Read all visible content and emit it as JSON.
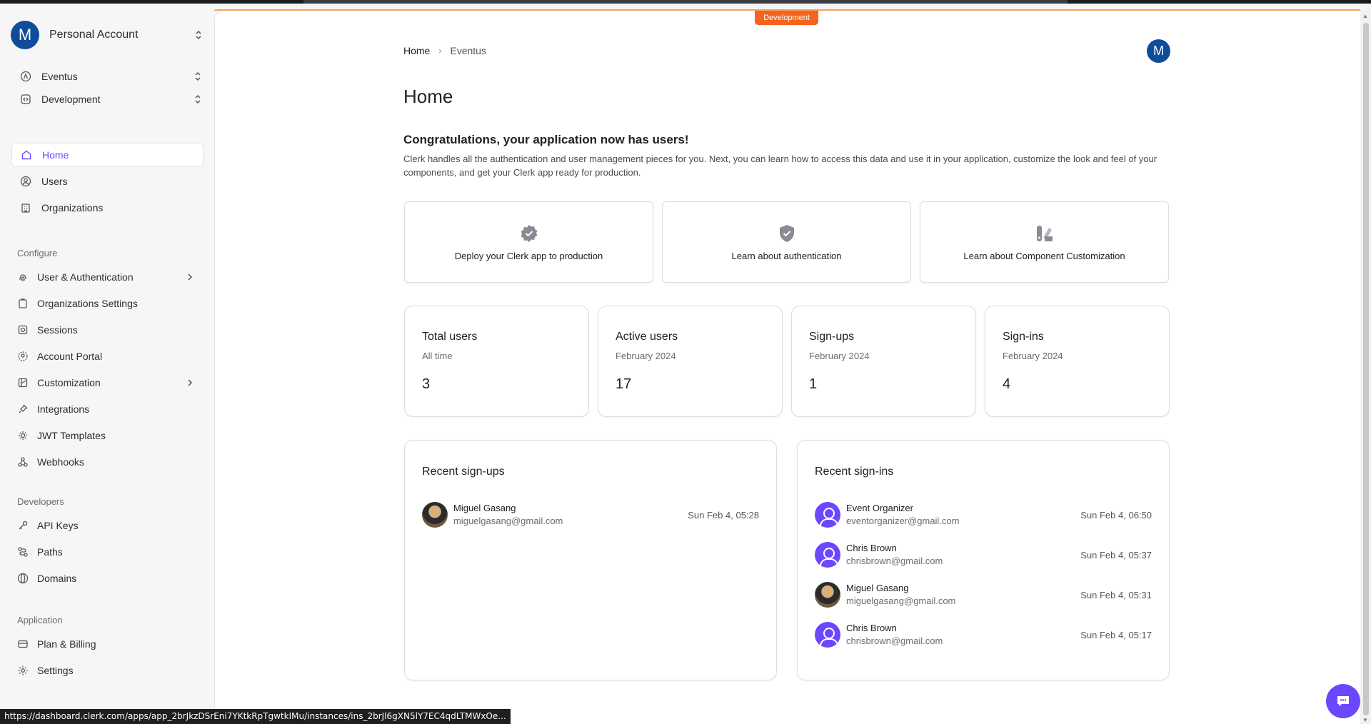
{
  "colors": {
    "accent": "#6c47ff",
    "dev_badge": "#f2641f",
    "avatar": "#0f4c9c"
  },
  "account": {
    "initial": "M",
    "name": "Personal Account"
  },
  "app_selector": {
    "label": "Eventus"
  },
  "env_selector": {
    "label": "Development"
  },
  "nav": {
    "home": "Home",
    "users": "Users",
    "organizations": "Organizations"
  },
  "configure": {
    "heading": "Configure",
    "items": [
      "User & Authentication",
      "Organizations Settings",
      "Sessions",
      "Account Portal",
      "Customization",
      "Integrations",
      "JWT Templates",
      "Webhooks"
    ]
  },
  "developers": {
    "heading": "Developers",
    "items": [
      "API Keys",
      "Paths",
      "Domains"
    ]
  },
  "application": {
    "heading": "Application",
    "items": [
      "Plan & Billing",
      "Settings"
    ]
  },
  "env_badge": "Development",
  "breadcrumb": {
    "home": "Home",
    "current": "Eventus"
  },
  "user_avatar_initial": "M",
  "page_title": "Home",
  "congrats": {
    "title": "Congratulations, your application now has users!",
    "description": "Clerk handles all the authentication and user management pieces for you. Next, you can learn how to access this data and use it in your application, customize the look and feel of your components, and get your Clerk app ready for production."
  },
  "quick_links": [
    {
      "label": "Deploy your Clerk app to production",
      "icon": "badge-check-icon"
    },
    {
      "label": "Learn about authentication",
      "icon": "shield-check-icon"
    },
    {
      "label": "Learn about Component Customization",
      "icon": "palette-icon"
    }
  ],
  "stats": [
    {
      "title": "Total users",
      "subtitle": "All time",
      "value": "3"
    },
    {
      "title": "Active users",
      "subtitle": "February 2024",
      "value": "17"
    },
    {
      "title": "Sign-ups",
      "subtitle": "February 2024",
      "value": "1"
    },
    {
      "title": "Sign-ins",
      "subtitle": "February 2024",
      "value": "4"
    }
  ],
  "recent_signups": {
    "title": "Recent sign-ups",
    "rows": [
      {
        "name": "Miguel Gasang",
        "email": "miguelgasang@gmail.com",
        "date": "Sun Feb 4, 05:28",
        "avatar": "photo"
      }
    ]
  },
  "recent_signins": {
    "title": "Recent sign-ins",
    "rows": [
      {
        "name": "Event Organizer",
        "email": "eventorganizer@gmail.com",
        "date": "Sun Feb 4, 06:50",
        "avatar": "default"
      },
      {
        "name": "Chris Brown",
        "email": "chrisbrown@gmail.com",
        "date": "Sun Feb 4, 05:37",
        "avatar": "default"
      },
      {
        "name": "Miguel Gasang",
        "email": "miguelgasang@gmail.com",
        "date": "Sun Feb 4, 05:31",
        "avatar": "photo"
      },
      {
        "name": "Chris Brown",
        "email": "chrisbrown@gmail.com",
        "date": "Sun Feb 4, 05:17",
        "avatar": "default"
      }
    ]
  },
  "status_url": "https://dashboard.clerk.com/apps/app_2brJkzDSrEni7YKtkRpTgwtkIMu/instances/ins_2brJl6gXN5lY7EC4qdLTMWxOe..."
}
